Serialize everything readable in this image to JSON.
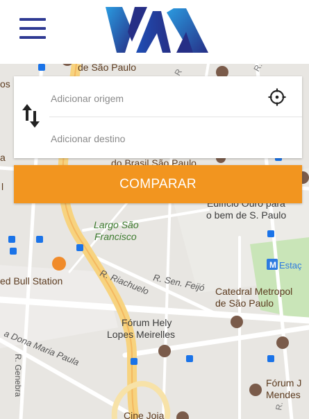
{
  "header": {
    "menu_icon": "hamburger-menu-icon",
    "logo_icon": "yaa-logo",
    "brand_colors": {
      "menu": "#2f3a93",
      "logo_dark": "#262f86",
      "logo_light": "#2a9be0"
    }
  },
  "route_form": {
    "origin_placeholder": "Adicionar origem",
    "destination_placeholder": "Adicionar destino",
    "swap_icon": "swap-arrows-icon",
    "locate_icon": "crosshair-locate-icon"
  },
  "compare_button": {
    "label": "COMPARAR",
    "color": "#f2951f"
  },
  "map": {
    "labels": {
      "se": "de São Paulo",
      "os": "os",
      "a": "a",
      "l": "l",
      "banco_brasil": "do Brasil São Paulo",
      "edificio_1": "Edifício Ouro para",
      "edificio_2": "o bem de S. Paulo",
      "largo_1": "Largo São",
      "largo_2": "Francisco",
      "metro_letter": "M",
      "estacao": "Estaç",
      "red_bull": "ed Bull Station",
      "riachuelo": "R. Riachuelo",
      "feijo": "R. Sen. Feijó",
      "catedral_1": "Catedral Metropol",
      "catedral_2": "de São Paulo",
      "forum_hely_1": "Fórum Hely",
      "forum_hely_2": "Lopes Meirelles",
      "dona_maria": "a Dona Maria Paula",
      "genebra": "R. Genebra",
      "forum_j_1": "Fórum J",
      "forum_j_2": "Mendes",
      "cine": "Cine Joia",
      "r_top": "R.",
      "r_right": "R.",
      "r_right2": "R"
    },
    "colors": {
      "land": "#e8e6e2",
      "road": "#ffffff",
      "highway": "#f7d37f",
      "park": "#c9e5b8",
      "bus_stop": "#1a73e8",
      "poi": "#7a5b4a",
      "metro": "#2d7be0",
      "label": "#5b3a1e"
    }
  }
}
